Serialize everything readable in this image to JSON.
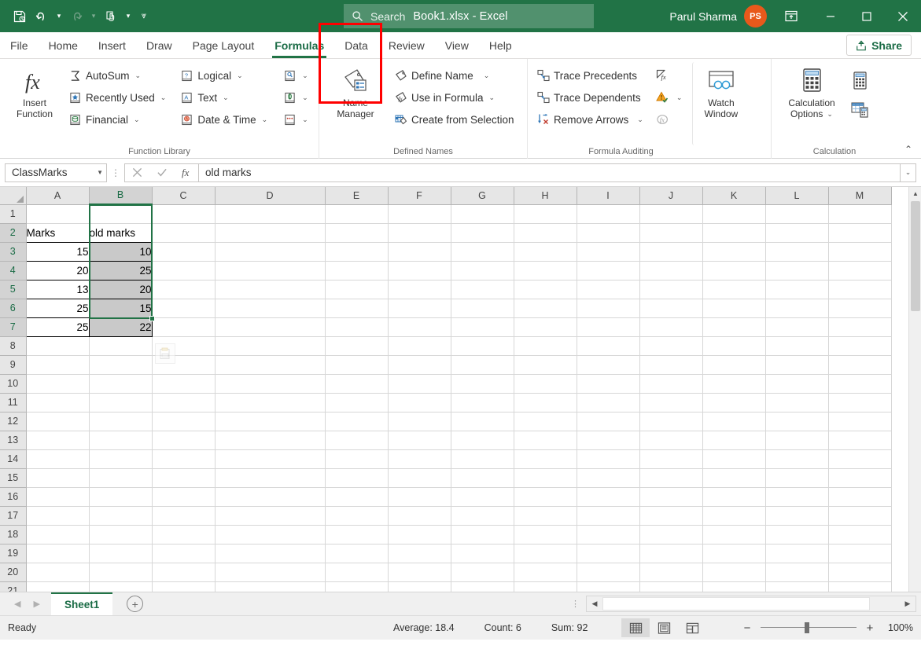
{
  "titlebar": {
    "doc_title": "Book1.xlsx  -  Excel",
    "user_name": "Parul Sharma",
    "avatar_initials": "PS",
    "search_placeholder": "Search",
    "qat": [
      {
        "name": "save-icon",
        "label": "Save"
      },
      {
        "name": "undo-icon",
        "label": "Undo"
      },
      {
        "name": "redo-icon",
        "label": "Redo"
      },
      {
        "name": "touch-mode-icon",
        "label": "Touch/Mouse Mode"
      },
      {
        "name": "customize-qat-icon",
        "label": "Customize Quick Access Toolbar"
      }
    ],
    "window": {
      "ribbon_display": "Ribbon Display Options",
      "minimize": "Minimize",
      "maximize": "Maximize",
      "close": "Close"
    },
    "colors": {
      "green": "#217346",
      "avatar": "#e8591b"
    }
  },
  "tabs": [
    {
      "label": "File",
      "active": false
    },
    {
      "label": "Home",
      "active": false
    },
    {
      "label": "Insert",
      "active": false
    },
    {
      "label": "Draw",
      "active": false
    },
    {
      "label": "Page Layout",
      "active": false
    },
    {
      "label": "Formulas",
      "active": true
    },
    {
      "label": "Data",
      "active": false
    },
    {
      "label": "Review",
      "active": false
    },
    {
      "label": "View",
      "active": false
    },
    {
      "label": "Help",
      "active": false
    }
  ],
  "share": {
    "label": "Share"
  },
  "ribbon": {
    "groups": [
      {
        "name": "function-library",
        "label": "Function Library",
        "big_button": {
          "line1": "Insert",
          "line2": "Function",
          "icon": "fx-icon"
        },
        "column1": [
          {
            "label": "AutoSum",
            "icon": "sigma-icon",
            "caret": true
          },
          {
            "label": "Recently Used",
            "icon": "recently-used-icon",
            "caret": true
          },
          {
            "label": "Financial",
            "icon": "financial-icon",
            "caret": true
          }
        ],
        "column2": [
          {
            "label": "Logical",
            "icon": "logical-icon",
            "caret": true
          },
          {
            "label": "Text",
            "icon": "text-function-icon",
            "caret": true
          },
          {
            "label": "Date & Time",
            "icon": "date-time-icon",
            "caret": true
          }
        ],
        "column3": [
          {
            "label": "",
            "icon": "lookup-reference-icon",
            "caret": true
          },
          {
            "label": "",
            "icon": "math-trig-icon",
            "caret": true
          },
          {
            "label": "",
            "icon": "more-functions-icon",
            "caret": true
          }
        ]
      },
      {
        "name": "defined-names",
        "label": "Defined Names",
        "big_button": {
          "line1": "Name",
          "line2": "Manager",
          "icon": "name-manager-icon",
          "highlighted": true
        },
        "column1": [
          {
            "label": "Define Name",
            "icon": "define-name-icon",
            "caret": true
          },
          {
            "label": "Use in Formula",
            "icon": "use-in-formula-icon",
            "caret": true
          },
          {
            "label": "Create from Selection",
            "icon": "create-from-selection-icon",
            "caret": false
          }
        ]
      },
      {
        "name": "formula-auditing",
        "label": "Formula Auditing",
        "column1": [
          {
            "label": "Trace Precedents",
            "icon": "trace-precedents-icon",
            "caret": false
          },
          {
            "label": "Trace Dependents",
            "icon": "trace-dependents-icon",
            "caret": false
          },
          {
            "label": "Remove Arrows",
            "icon": "remove-arrows-icon",
            "caret": true
          }
        ],
        "column2": [
          {
            "label": "",
            "icon": "show-formulas-icon",
            "caret": false
          },
          {
            "label": "",
            "icon": "error-checking-icon",
            "caret": true
          },
          {
            "label": "",
            "icon": "evaluate-formula-icon",
            "caret": false
          }
        ],
        "big_button2": {
          "line1": "Watch",
          "line2": "Window",
          "icon": "watch-window-icon"
        }
      },
      {
        "name": "calculation",
        "label": "Calculation",
        "big_button": {
          "line1": "Calculation",
          "line2": "Options",
          "icon": "calculation-options-icon",
          "caret": true
        },
        "column1": [
          {
            "label": "",
            "icon": "calculate-now-icon",
            "caret": false
          },
          {
            "label": "",
            "icon": "calculate-sheet-icon",
            "caret": false
          }
        ]
      }
    ],
    "collapse_label": "Collapse the Ribbon"
  },
  "formula_bar": {
    "name_box_value": "ClassMarks",
    "cancel_label": "Cancel",
    "enter_label": "Enter",
    "insert_function_label": "Insert Function",
    "formula_value": "old marks",
    "expand_label": "Expand Formula Bar"
  },
  "grid": {
    "columns": [
      "A",
      "B",
      "C",
      "D",
      "E",
      "F",
      "G",
      "H",
      "I",
      "J",
      "K",
      "L",
      "M"
    ],
    "selected_column": "B",
    "rows": [
      "1",
      "2",
      "3",
      "4",
      "5",
      "6",
      "7",
      "8",
      "9",
      "10",
      "11",
      "12",
      "13",
      "14",
      "15",
      "16",
      "17",
      "18",
      "19",
      "20",
      "21"
    ],
    "selected_rows": [
      "2",
      "3",
      "4",
      "5",
      "6",
      "7"
    ],
    "cells": {
      "A2": "Marks",
      "B2": "old marks",
      "A3": "15",
      "B3": "10",
      "A4": "20",
      "B4": "25",
      "A5": "13",
      "B5": "20",
      "A6": "25",
      "B6": "15",
      "A7": "25",
      "B7": "22"
    },
    "selection_range": "B2:B7",
    "selection_color": "#217346",
    "paste_options_label": "Paste Options"
  },
  "sheet_bar": {
    "prev_label": "Previous Sheet",
    "next_label": "Next Sheet",
    "sheets": [
      {
        "label": "Sheet1",
        "active": true
      }
    ],
    "add_sheet_label": "New sheet"
  },
  "status_bar": {
    "mode": "Ready",
    "stats": [
      {
        "label": "Average: 18.4"
      },
      {
        "label": "Count: 6"
      },
      {
        "label": "Sum: 92"
      }
    ],
    "views": [
      {
        "name": "normal-view-icon",
        "label": "Normal",
        "active": true
      },
      {
        "name": "page-layout-view-icon",
        "label": "Page Layout",
        "active": false
      },
      {
        "name": "page-break-preview-icon",
        "label": "Page Break Preview",
        "active": false
      }
    ],
    "zoom_out": "−",
    "zoom_in": "+",
    "zoom_level": "100%"
  }
}
